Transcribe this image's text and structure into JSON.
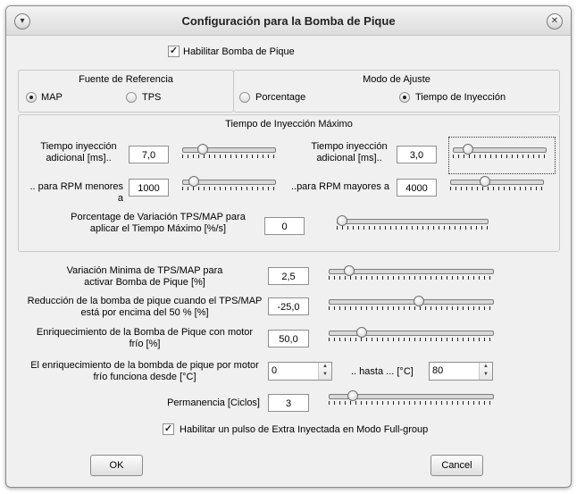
{
  "window": {
    "title": "Configuración para la Bomba de Pique"
  },
  "enable": {
    "label": "Habilitar Bomba de Pique",
    "checked": true
  },
  "fuente": {
    "title": "Fuente de Referencia",
    "options": [
      {
        "label": "MAP",
        "selected": true
      },
      {
        "label": "TPS",
        "selected": false
      }
    ]
  },
  "modo": {
    "title": "Modo de Ajuste",
    "options": [
      {
        "label": "Porcentage",
        "selected": false
      },
      {
        "label": "Tiempo de Inyección",
        "selected": true
      }
    ]
  },
  "tiempo": {
    "title": "Tiempo de Inyección Máximo",
    "left_time": {
      "label1": "Tiempo inyección",
      "label2": "adicional [ms]..",
      "value": "7,0",
      "level": 0.18
    },
    "right_time": {
      "label1": "Tiempo inyección",
      "label2": "adicional [ms]..",
      "value": "3,0",
      "level": 0.12
    },
    "rpm_low": {
      "label": ".. para RPM menores a",
      "value": "1000",
      "level": 0.08
    },
    "rpm_high": {
      "label": "..para RPM mayores a",
      "value": "4000",
      "level": 0.35
    },
    "variation": {
      "label1": "Porcentage de Variación TPS/MAP para",
      "label2": "aplicar el Tiempo Máximo [%/s]",
      "value": "0",
      "level": 0.0
    }
  },
  "settings": {
    "min_variation": {
      "label1": "Variación Minima de TPS/MAP para",
      "label2": "activar Bomba de Pique  [%]",
      "value": "2,5",
      "level": 0.1
    },
    "reduction": {
      "label1": "Reducción de la bomba de pique cuando el TPS/MAP",
      "label2": "está por encima del 50 % [%]",
      "value": "-25,0",
      "level": 0.55
    },
    "cold_enrich": {
      "label1": "Enriquecimiento de la Bomba de Pique con motor",
      "label2": "frío [%]",
      "value": "50,0",
      "level": 0.18
    },
    "cold_range": {
      "label1": "El enriquecimiento de la bombda de pique por motor",
      "label2": "frío funciona desde [°C]",
      "from": "0",
      "hasta_label": "..  hasta ... [°C]",
      "to": "80"
    },
    "permanence": {
      "label": "Permanencia [Ciclos]",
      "value": "3",
      "level": 0.12
    }
  },
  "extra_pulse": {
    "label": "Habilitar un pulso de Extra Inyectada en Modo Full-group",
    "checked": true
  },
  "buttons": {
    "ok": "OK",
    "cancel": "Cancel"
  }
}
